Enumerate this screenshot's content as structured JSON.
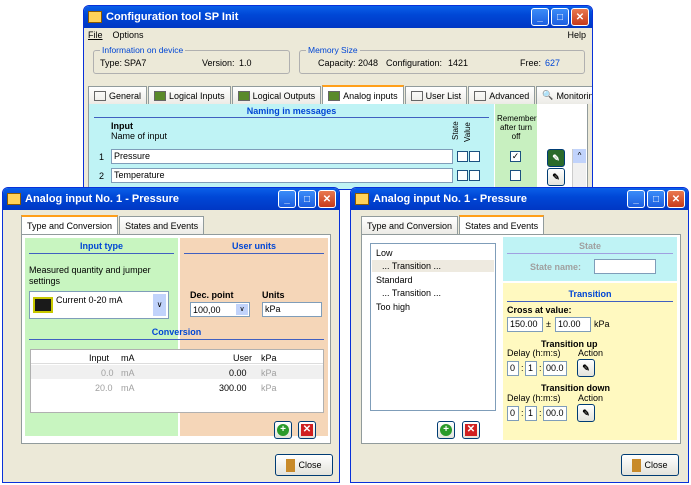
{
  "main": {
    "title": "Configuration tool SP Init",
    "menu": {
      "file": "File",
      "options": "Options",
      "help": "Help"
    },
    "device": {
      "group_title": "Information on device",
      "type_label": "Type:",
      "type_value": "SPA7",
      "version_label": "Version:",
      "version_value": "1.0"
    },
    "memory": {
      "group_title": "Memory Size",
      "capacity_label": "Capacity:",
      "capacity_value": "2048",
      "config_label": "Configuration:",
      "config_value": "1421",
      "free_label": "Free:",
      "free_value": "627"
    },
    "tabs": [
      "General",
      "Logical Inputs",
      "Logical Outputs",
      "Analog inputs",
      "User List",
      "Advanced",
      "Monitoring"
    ],
    "naming_header": "Naming in messages",
    "col_input": "Input",
    "col_name": "Name of input",
    "col_state": "State",
    "col_value": "Value",
    "remember_header": "Remember after turn off",
    "rows": [
      {
        "num": "1",
        "name": "Pressure"
      },
      {
        "num": "2",
        "name": "Temperature"
      }
    ]
  },
  "left": {
    "title": "Analog input No. 1 - Pressure",
    "tabs": [
      "Type and Conversion",
      "States and Events"
    ],
    "input_type_header": "Input type",
    "measured_label": "Measured quantity and jumper settings",
    "measured_value": "Current 0-20 mA",
    "user_units_header": "User units",
    "dec_point_label": "Dec. point",
    "dec_point_value": "100,00",
    "units_label": "Units",
    "units_value": "kPa",
    "conversion_header": "Conversion",
    "conv_headers": [
      "Input",
      "mA",
      "User",
      "kPa"
    ],
    "conv_rows": [
      [
        "0.0",
        "mA",
        "0.00",
        "kPa"
      ],
      [
        "20.0",
        "mA",
        "300.00",
        "kPa"
      ]
    ],
    "close": "Close"
  },
  "right": {
    "title": "Analog input No. 1 - Pressure",
    "tabs": [
      "Type and Conversion",
      "States and Events"
    ],
    "states": [
      "Low",
      "... Transition ...",
      "Standard",
      "... Transition ...",
      "Too high"
    ],
    "state_header": "State",
    "state_name_label": "State name:",
    "transition_header": "Transition",
    "cross_label": "Cross at value:",
    "cross_value": "150.00",
    "pm": "±",
    "tolerance": "10.00",
    "unit": "kPa",
    "up_header": "Transition up",
    "down_header": "Transition down",
    "delay_label": "Delay (h:m:s)",
    "action_label": "Action",
    "up": {
      "h": "0",
      "m": "1",
      "s": "00.0"
    },
    "down": {
      "h": "0",
      "m": "1",
      "s": "00.0"
    },
    "close": "Close"
  }
}
